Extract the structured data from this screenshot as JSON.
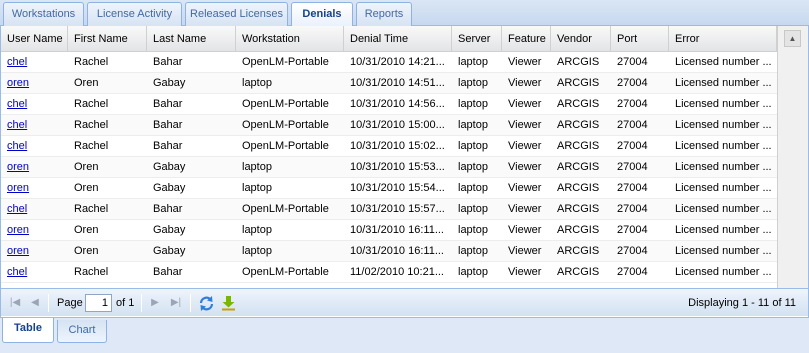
{
  "top_tabs": [
    {
      "label": "Workstations"
    },
    {
      "label": "License Activity"
    },
    {
      "label": "Released Licenses"
    },
    {
      "label": "Denials"
    },
    {
      "label": "Reports"
    }
  ],
  "columns": [
    "User Name",
    "First Name",
    "Last Name",
    "Workstation",
    "Denial Time",
    "Server",
    "Feature",
    "Vendor",
    "Port",
    "Error"
  ],
  "rows": [
    [
      "chel",
      "Rachel",
      "Bahar",
      "OpenLM-Portable",
      "10/31/2010 14:21...",
      "laptop",
      "Viewer",
      "ARCGIS",
      "27004",
      "Licensed number ..."
    ],
    [
      "oren",
      "Oren",
      "Gabay",
      "laptop",
      "10/31/2010 14:51...",
      "laptop",
      "Viewer",
      "ARCGIS",
      "27004",
      "Licensed number ..."
    ],
    [
      "chel",
      "Rachel",
      "Bahar",
      "OpenLM-Portable",
      "10/31/2010 14:56...",
      "laptop",
      "Viewer",
      "ARCGIS",
      "27004",
      "Licensed number ..."
    ],
    [
      "chel",
      "Rachel",
      "Bahar",
      "OpenLM-Portable",
      "10/31/2010 15:00...",
      "laptop",
      "Viewer",
      "ARCGIS",
      "27004",
      "Licensed number ..."
    ],
    [
      "chel",
      "Rachel",
      "Bahar",
      "OpenLM-Portable",
      "10/31/2010 15:02...",
      "laptop",
      "Viewer",
      "ARCGIS",
      "27004",
      "Licensed number ..."
    ],
    [
      "oren",
      "Oren",
      "Gabay",
      "laptop",
      "10/31/2010 15:53...",
      "laptop",
      "Viewer",
      "ARCGIS",
      "27004",
      "Licensed number ..."
    ],
    [
      "oren",
      "Oren",
      "Gabay",
      "laptop",
      "10/31/2010 15:54...",
      "laptop",
      "Viewer",
      "ARCGIS",
      "27004",
      "Licensed number ..."
    ],
    [
      "chel",
      "Rachel",
      "Bahar",
      "OpenLM-Portable",
      "10/31/2010 15:57...",
      "laptop",
      "Viewer",
      "ARCGIS",
      "27004",
      "Licensed number ..."
    ],
    [
      "oren",
      "Oren",
      "Gabay",
      "laptop",
      "10/31/2010 16:11...",
      "laptop",
      "Viewer",
      "ARCGIS",
      "27004",
      "Licensed number ..."
    ],
    [
      "oren",
      "Oren",
      "Gabay",
      "laptop",
      "10/31/2010 16:11...",
      "laptop",
      "Viewer",
      "ARCGIS",
      "27004",
      "Licensed number ..."
    ],
    [
      "chel",
      "Rachel",
      "Bahar",
      "OpenLM-Portable",
      "11/02/2010 10:21...",
      "laptop",
      "Viewer",
      "ARCGIS",
      "27004",
      "Licensed number ..."
    ]
  ],
  "pager": {
    "page_label": "Page",
    "page_value": "1",
    "of_label": "of 1",
    "displaying": "Displaying 1 - 11 of 11"
  },
  "bottom_tabs": [
    {
      "label": "Table"
    },
    {
      "label": "Chart"
    }
  ],
  "colors": {
    "link": "#0000cc",
    "active_tab_text": "#15428b",
    "tab_border": "#99bbe8"
  }
}
